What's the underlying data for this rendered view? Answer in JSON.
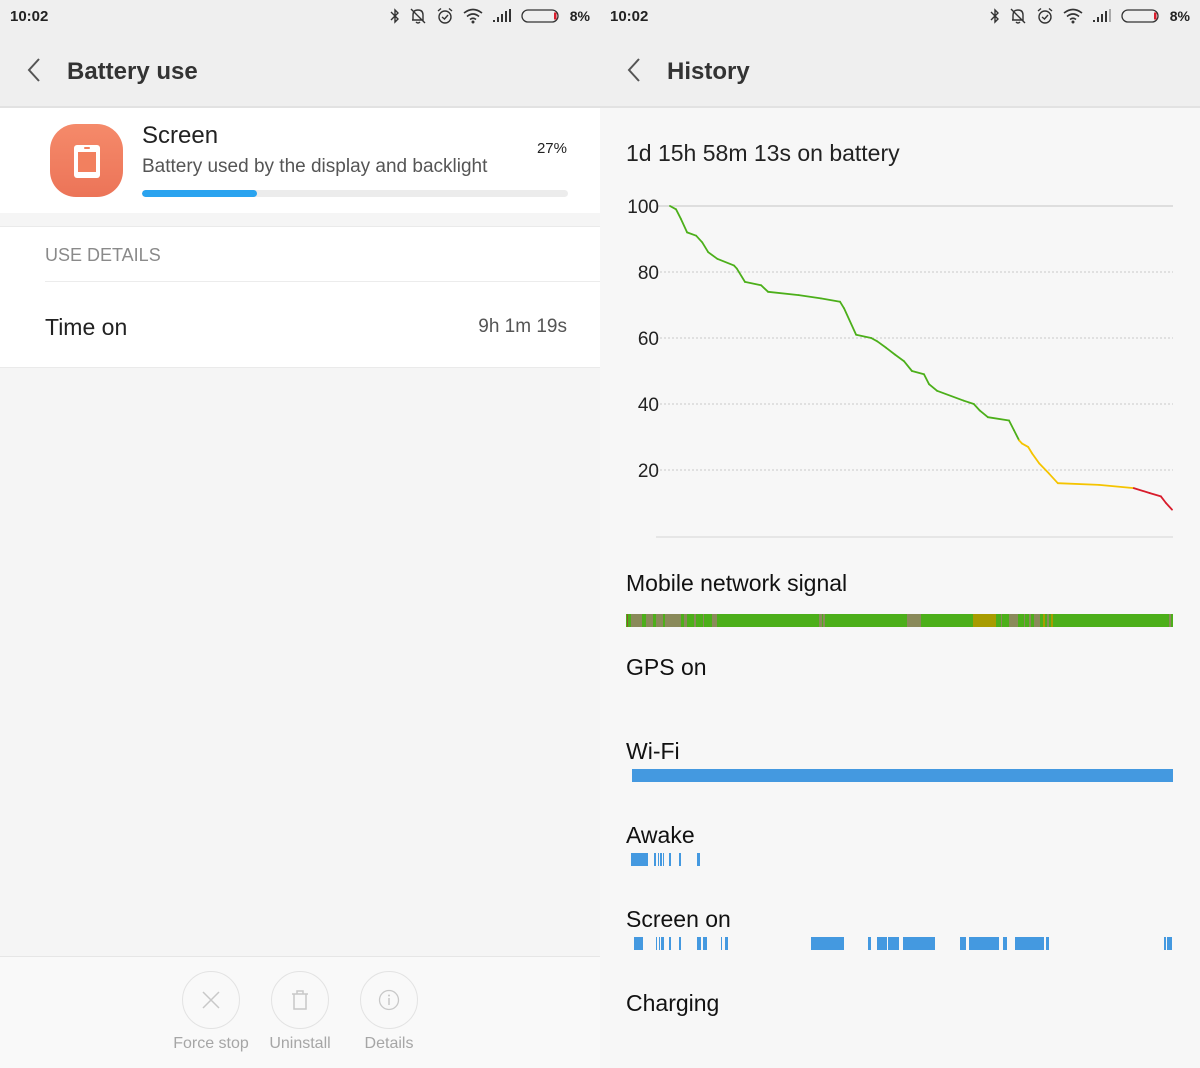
{
  "status_bar": {
    "time": "10:02",
    "icons": [
      "bluetooth-icon",
      "bell-muted-icon",
      "alarm-icon",
      "wifi-icon",
      "cell-signal-icon",
      "battery-icon"
    ],
    "battery_percent": "8%",
    "battery_level": 0.08
  },
  "left": {
    "header": {
      "title": "Battery use"
    },
    "app": {
      "name": "Screen",
      "description": "Battery used by the display and backlight",
      "percent_label": "27%",
      "usage_fraction": 0.27,
      "icon": "tablet-icon",
      "icon_color": "#ee7a5c",
      "bar_color": "#2aa3ef"
    },
    "details": {
      "section_label": "USE DETAILS",
      "rows": [
        {
          "label": "Time on",
          "value": "9h 1m 19s"
        }
      ]
    },
    "actions": [
      {
        "label": "Force stop",
        "icon": "close-icon"
      },
      {
        "label": "Uninstall",
        "icon": "trash-icon"
      },
      {
        "label": "Details",
        "icon": "info-icon"
      }
    ]
  },
  "right": {
    "header": {
      "title": "History"
    },
    "on_battery": "1d 15h 58m 13s on battery",
    "sections": [
      {
        "label": "Mobile network signal"
      },
      {
        "label": "GPS on"
      },
      {
        "label": "Wi-Fi"
      },
      {
        "label": "Awake"
      },
      {
        "label": "Screen on"
      },
      {
        "label": "Charging"
      }
    ],
    "timelines": {
      "mobile_signal": {
        "base_color": "#4caf1a",
        "segments": [
          {
            "start": 0.001,
            "end": 0.004,
            "color": "#8b5a2b"
          },
          {
            "start": 0.01,
            "end": 0.03,
            "color": "#8a8a5a"
          },
          {
            "start": 0.036,
            "end": 0.05,
            "color": "#8a8a5a"
          },
          {
            "start": 0.055,
            "end": 0.068,
            "color": "#8a8a5a"
          },
          {
            "start": 0.072,
            "end": 0.1,
            "color": "#8a8a5a"
          },
          {
            "start": 0.106,
            "end": 0.112,
            "color": "#8a8a5a"
          },
          {
            "start": 0.125,
            "end": 0.128,
            "color": "#8a8a5a"
          },
          {
            "start": 0.14,
            "end": 0.143,
            "color": "#8a8a5a"
          },
          {
            "start": 0.158,
            "end": 0.166,
            "color": "#8a8a5a"
          },
          {
            "start": 0.353,
            "end": 0.358,
            "color": "#8a8a5a"
          },
          {
            "start": 0.361,
            "end": 0.364,
            "color": "#8a8a5a"
          },
          {
            "start": 0.514,
            "end": 0.54,
            "color": "#8a8a5a"
          },
          {
            "start": 0.634,
            "end": 0.677,
            "color": "#a89c00"
          },
          {
            "start": 0.685,
            "end": 0.688,
            "color": "#8a8a5a"
          },
          {
            "start": 0.7,
            "end": 0.716,
            "color": "#8a8a5a"
          },
          {
            "start": 0.727,
            "end": 0.73,
            "color": "#8a8a5a"
          },
          {
            "start": 0.737,
            "end": 0.74,
            "color": "#8a8a5a"
          },
          {
            "start": 0.746,
            "end": 0.757,
            "color": "#8a8a5a"
          },
          {
            "start": 0.762,
            "end": 0.766,
            "color": "#a89c00"
          },
          {
            "start": 0.77,
            "end": 0.773,
            "color": "#8a8a5a"
          },
          {
            "start": 0.777,
            "end": 0.78,
            "color": "#a89c00"
          },
          {
            "start": 0.992,
            "end": 0.997,
            "color": "#8a8a5a"
          }
        ]
      },
      "gps": {
        "segments": []
      },
      "wifi": {
        "color": "#4499e0",
        "segments": [
          {
            "start": 0.011,
            "end": 1.0
          }
        ]
      },
      "awake": {
        "color": "#4499e0",
        "segments": [
          {
            "start": 0.01,
            "end": 0.041
          },
          {
            "start": 0.052,
            "end": 0.055
          },
          {
            "start": 0.058,
            "end": 0.061
          },
          {
            "start": 0.063,
            "end": 0.066
          },
          {
            "start": 0.067,
            "end": 0.069
          },
          {
            "start": 0.079,
            "end": 0.081
          },
          {
            "start": 0.097,
            "end": 0.099
          },
          {
            "start": 0.129,
            "end": 0.136
          }
        ]
      },
      "screen_on": {
        "color": "#4499e0",
        "segments": [
          {
            "start": 0.014,
            "end": 0.031
          },
          {
            "start": 0.054,
            "end": 0.057
          },
          {
            "start": 0.06,
            "end": 0.062
          },
          {
            "start": 0.064,
            "end": 0.066
          },
          {
            "start": 0.067,
            "end": 0.069
          },
          {
            "start": 0.079,
            "end": 0.081
          },
          {
            "start": 0.097,
            "end": 0.099
          },
          {
            "start": 0.129,
            "end": 0.137
          },
          {
            "start": 0.14,
            "end": 0.148
          },
          {
            "start": 0.173,
            "end": 0.175
          },
          {
            "start": 0.181,
            "end": 0.187
          },
          {
            "start": 0.338,
            "end": 0.399
          },
          {
            "start": 0.443,
            "end": 0.447
          },
          {
            "start": 0.459,
            "end": 0.477
          },
          {
            "start": 0.479,
            "end": 0.5
          },
          {
            "start": 0.506,
            "end": 0.565
          },
          {
            "start": 0.611,
            "end": 0.622
          },
          {
            "start": 0.627,
            "end": 0.681
          },
          {
            "start": 0.69,
            "end": 0.697
          },
          {
            "start": 0.711,
            "end": 0.765
          },
          {
            "start": 0.767,
            "end": 0.773
          },
          {
            "start": 0.984,
            "end": 0.987
          },
          {
            "start": 0.989,
            "end": 0.999
          }
        ]
      },
      "charging": {
        "segments": []
      }
    }
  },
  "chart_data": {
    "type": "line",
    "title": "1d 15h 58m 13s on battery",
    "xlabel": "",
    "ylabel": "",
    "ylim": [
      0,
      100
    ],
    "xlim": [
      0,
      1
    ],
    "y_ticks": [
      100,
      80,
      60,
      40,
      20
    ],
    "grid": true,
    "legend": "none",
    "color_thresholds": [
      {
        "min": 30,
        "color": "#4caf1a"
      },
      {
        "min": 15,
        "color": "#f5c400"
      },
      {
        "min": 0,
        "color": "#d81c2c"
      }
    ],
    "series": [
      {
        "name": "Battery level",
        "x": [
          0.0,
          0.012,
          0.022,
          0.034,
          0.052,
          0.064,
          0.076,
          0.094,
          0.127,
          0.133,
          0.149,
          0.181,
          0.195,
          0.256,
          0.3,
          0.338,
          0.346,
          0.37,
          0.4,
          0.412,
          0.43,
          0.447,
          0.465,
          0.481,
          0.505,
          0.515,
          0.531,
          0.584,
          0.604,
          0.616,
          0.632,
          0.674,
          0.684,
          0.694,
          0.7,
          0.712,
          0.72,
          0.734,
          0.753,
          0.771,
          0.853,
          0.922,
          0.954,
          0.976,
          0.986,
          0.998
        ],
        "values": [
          100,
          99,
          96,
          92,
          91,
          89,
          86,
          84,
          82,
          81,
          77,
          76,
          74,
          73,
          72,
          71,
          69,
          61,
          60,
          59,
          57,
          55,
          53,
          50,
          49,
          46,
          44,
          41,
          40,
          38,
          36,
          35,
          32,
          29,
          28,
          27,
          25,
          22,
          19,
          16,
          15.5,
          14.5,
          13,
          12,
          10,
          8
        ]
      }
    ]
  }
}
